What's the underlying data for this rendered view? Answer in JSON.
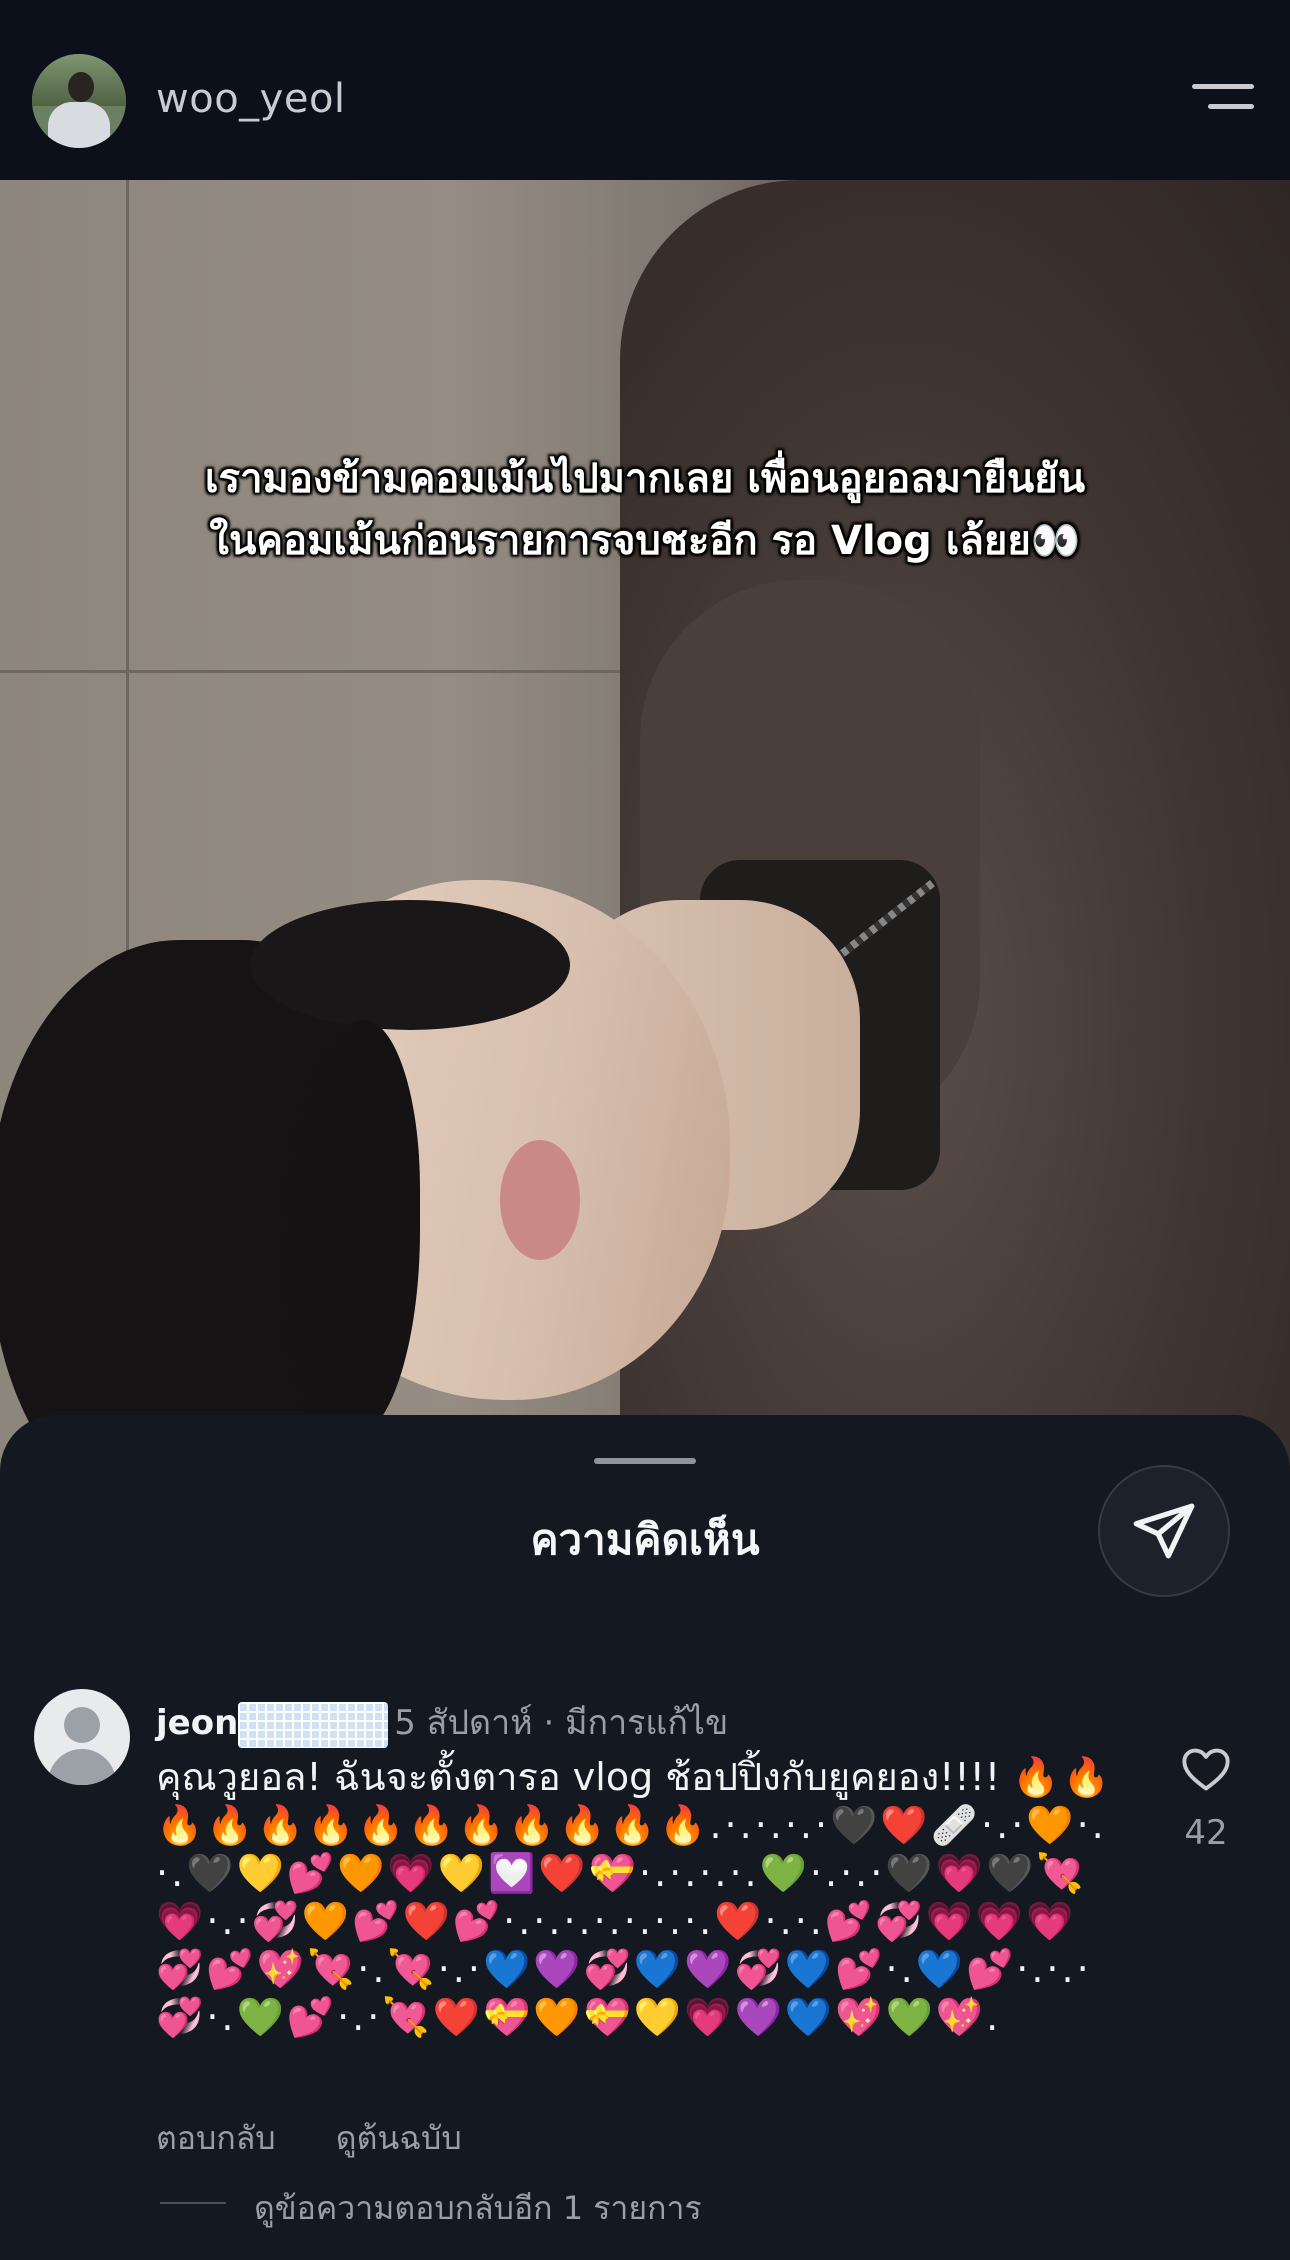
{
  "header": {
    "username": "woo_yeol",
    "avatar_icon": "user-photo-avatar",
    "menu_icon": "menu-icon"
  },
  "post": {
    "caption_lines": [
      "เรามองข้ามคอมเม้นไปมากเลย เพื่อนอูยอลมายืนยัน",
      "ในคอมเม้นก่อนรายการจบชะอีก รอ Vlog เล้ยย👀"
    ]
  },
  "comments_sheet": {
    "title": "ความคิดเห็น",
    "share_icon": "send-icon",
    "comment": {
      "username": "jeon",
      "username_redacted": true,
      "time": "5 สัปดาห์",
      "edited": "มีการแก้ไข",
      "separator": "·",
      "text": "คุณวูยอล! ฉันจะตั้งตารอ vlog ช้อปปิ้งกับยูคยอง!!!! ",
      "emoji": "🔥🔥🔥🔥🔥🔥🔥🔥🔥🔥🔥🔥🔥.·.·.·.·🖤❤️🩹·.·🧡·.·.🖤💛💕🧡💗💛💟❤️💝·.·.·.·.💚·.·.·🖤💗🖤💘💗·.·💞🧡💕❤️💕·.·.·.·.·.·.·.❤️·.·.💕💞💗💗💗💞💕💖💘·.💘·.·💙💜💞💙💜💞💙💕·.💙💕·.·.·💞·.💚💕·.·💘❤️💝🧡💝💛💗💜💙💖💚💖.",
      "like_count": "42",
      "like_icon": "heart-icon",
      "actions": {
        "reply": "ตอบกลับ",
        "see_translation": "ดูต้นฉบับ"
      },
      "view_replies": "ดูข้อความตอบกลับอีก 1 รายการ"
    }
  }
}
